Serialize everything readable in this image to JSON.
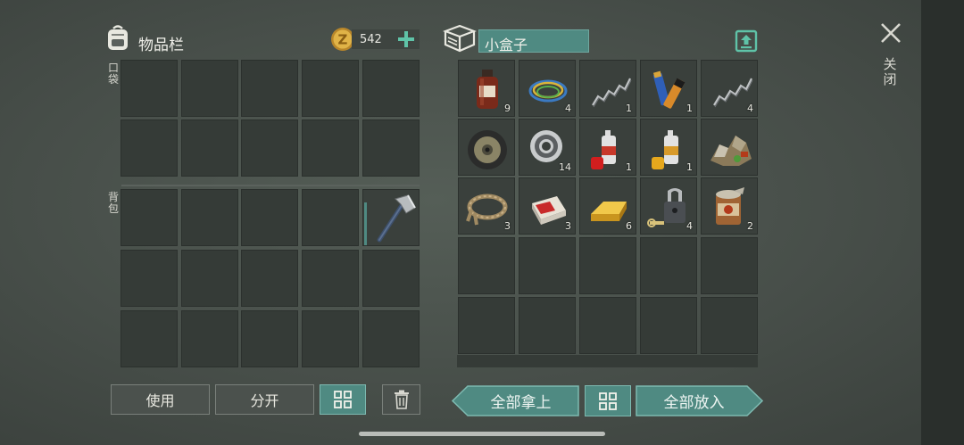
{
  "inventory": {
    "title": "物品栏",
    "icon": "backpack-icon",
    "coins": "542",
    "coin_icon": "z-coin-icon",
    "pocket_label": "口袋",
    "backpack_label": "背包"
  },
  "container": {
    "icon": "box-icon",
    "name": "小盒子"
  },
  "close_label": "关闭",
  "items": [
    {
      "name": "medicine-bottle",
      "count": "9"
    },
    {
      "name": "wire-coil",
      "count": "4"
    },
    {
      "name": "spring",
      "count": "1"
    },
    {
      "name": "batteries",
      "count": "1"
    },
    {
      "name": "spring",
      "count": "4"
    },
    {
      "name": "wheel-disc",
      "count": ""
    },
    {
      "name": "bearing",
      "count": "14"
    },
    {
      "name": "red-spray-can",
      "count": "1"
    },
    {
      "name": "yellow-spray-can",
      "count": "1"
    },
    {
      "name": "scrap-pile",
      "count": ""
    },
    {
      "name": "rope",
      "count": "3"
    },
    {
      "name": "cigarette-pack",
      "count": "3"
    },
    {
      "name": "gold-bar",
      "count": "6"
    },
    {
      "name": "padlock-key",
      "count": "4"
    },
    {
      "name": "tin-can",
      "count": "2"
    }
  ],
  "buttons": {
    "use": "使用",
    "split": "分开",
    "take_all": "全部拿上",
    "put_all": "全部放入"
  },
  "colors": {
    "accent_teal": "#4f8a82",
    "coin_gold": "#d9a53a",
    "plus_green": "#5fc3a8"
  }
}
